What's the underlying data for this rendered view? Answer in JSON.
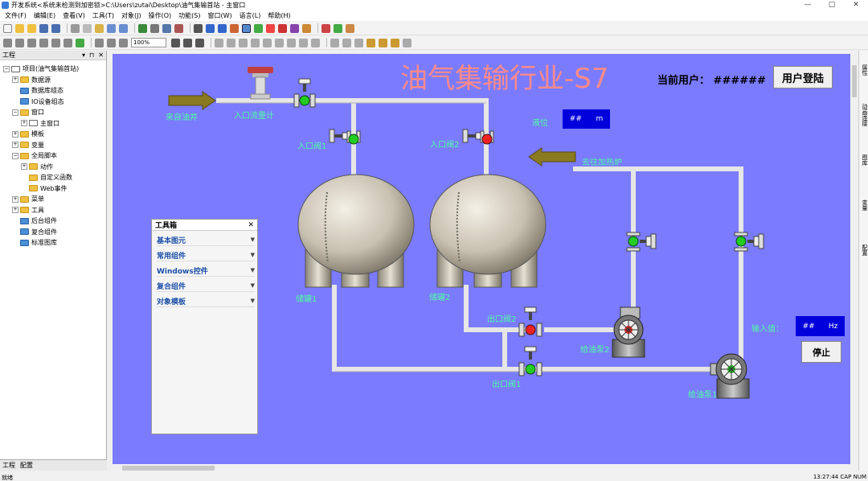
{
  "window": {
    "title": "开发系统<系统未检测到加密锁>C:\\Users\\zutai\\Desktop\\油气集输首站 - 主窗口",
    "controls": {
      "minimize": "—",
      "maximize": "▢",
      "close": "✕"
    }
  },
  "menu": [
    "文件(F)",
    "编辑(E)",
    "查看(V)",
    "工具(T)",
    "对象(J)",
    "操作(O)",
    "功能(S)",
    "窗口(W)",
    "语言(L)",
    "帮助(H)"
  ],
  "toolbar": {
    "zoom": "100%"
  },
  "project_panel": {
    "title": "工程",
    "controls": [
      "▾",
      "⊓",
      "✕"
    ],
    "tree": [
      {
        "label": "项目(油气集输首站)",
        "level": 0,
        "expand": "−",
        "icon": "doc"
      },
      {
        "label": "数据源",
        "level": 1,
        "expand": "+",
        "icon": "folder"
      },
      {
        "label": "数据库组态",
        "level": 1,
        "expand": "",
        "icon": "blue"
      },
      {
        "label": "IO设备组态",
        "level": 1,
        "expand": "",
        "icon": "blue"
      },
      {
        "label": "窗口",
        "level": 1,
        "expand": "−",
        "icon": "folder"
      },
      {
        "label": "主窗口",
        "level": 2,
        "expand": "+",
        "icon": "doc"
      },
      {
        "label": "模板",
        "level": 1,
        "expand": "+",
        "icon": "folder"
      },
      {
        "label": "变量",
        "level": 1,
        "expand": "+",
        "icon": "folder"
      },
      {
        "label": "全局脚本",
        "level": 1,
        "expand": "−",
        "icon": "folder"
      },
      {
        "label": "动作",
        "level": 2,
        "expand": "+",
        "icon": "folder"
      },
      {
        "label": "自定义函数",
        "level": 2,
        "expand": "",
        "icon": "folder"
      },
      {
        "label": "Web事件",
        "level": 2,
        "expand": "",
        "icon": "folder"
      },
      {
        "label": "菜单",
        "level": 1,
        "expand": "+",
        "icon": "folder"
      },
      {
        "label": "工具",
        "level": 1,
        "expand": "+",
        "icon": "folder"
      },
      {
        "label": "后台组件",
        "level": 1,
        "expand": "",
        "icon": "blue"
      },
      {
        "label": "复合组件",
        "level": 1,
        "expand": "",
        "icon": "blue"
      },
      {
        "label": "标准图库",
        "level": 1,
        "expand": "",
        "icon": "blue"
      }
    ],
    "tabs": [
      "工程",
      "配置"
    ]
  },
  "scada": {
    "title": "油气集输行业-S7",
    "current_user_label": "当前用户：",
    "current_user_value": "######",
    "login_button": "用户登陆",
    "labels": {
      "incoming_oil": "来自油井",
      "inlet_flowmeter": "入口流量计",
      "inlet_valve_1": "入口阀1",
      "inlet_valve_2": "入口阀2",
      "tank_1": "储罐1",
      "tank_2": "储罐2",
      "level": "液位",
      "to_heater": "去往加热炉",
      "outlet_valve_1": "出口阀1",
      "outlet_valve_2": "出口阀2",
      "oil_pump_2": "给油泵2",
      "oil_pump_1": "给油泵1",
      "input_value": "输入值："
    },
    "level_display": {
      "value": "##",
      "unit": "m"
    },
    "freq_display": {
      "value": "##",
      "unit": "Hz"
    },
    "stop_button": "停止",
    "colors": {
      "background": "#7b7bff",
      "label": "#4dffa0",
      "valve_open": "#22cc22",
      "valve_closed": "#ee2222",
      "display_box": "#0000dd"
    }
  },
  "toolbox": {
    "title": "工具箱",
    "close": "✕",
    "items": [
      "基本图元",
      "常用组件",
      "Windows控件",
      "复合组件",
      "对象模板"
    ]
  },
  "right_dock": [
    "属性",
    "动画连接",
    "图库",
    "变量",
    "配置"
  ],
  "status": {
    "left": "就绪",
    "right": "13:27:44  CAP  NUM"
  }
}
